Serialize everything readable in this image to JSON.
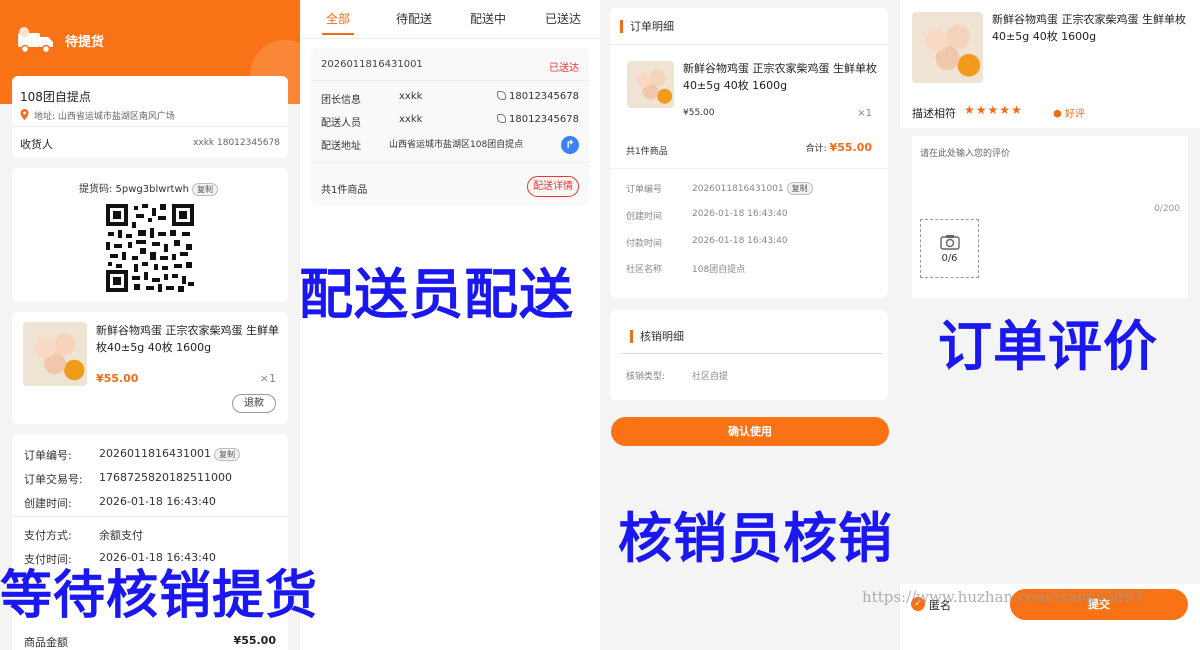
{
  "product": {
    "name": "新鲜谷物鸡蛋 正宗农家柴鸡蛋 生鲜单枚40±5g 40枚 1600g",
    "price": "¥55.00",
    "price_plain": "¥55.00",
    "qty": "×1"
  },
  "pickup_screen": {
    "header_title": "待提货",
    "store_name": "108团自提点",
    "address": "地址: 山西省运城市盐湖区南风广场",
    "receiver_label": "收货人",
    "receiver_value": "xxkk  18012345678",
    "pickup_code": "提货码: 5pwg3blwrtwh",
    "copy_label": "复制",
    "refund_label": "退款",
    "order_no_label": "订单编号:",
    "order_no": "2026011816431001",
    "trade_no_label": "订单交易号:",
    "trade_no": "1768725820182511000",
    "created_label": "创建时间:",
    "created": "2026-01-18 16:43:40",
    "pay_method_label": "支付方式:",
    "pay_method": "余额支付",
    "pay_time_label": "支付时间:",
    "pay_time": "2026-01-18 16:43:40",
    "goods_amount_label": "商品金额",
    "goods_amount": "¥55.00",
    "overlay_label": "等待核销提货"
  },
  "delivery_screen": {
    "tabs": [
      "全部",
      "待配送",
      "配送中",
      "已送达"
    ],
    "order_no": "2026011816431001",
    "status": "已送达",
    "leader_label": "团长信息",
    "leader_name": "xxkk",
    "leader_phone": "18012345678",
    "courier_label": "配送人员",
    "courier_name": "xxkk",
    "courier_phone": "18012345678",
    "address_label": "配送地址",
    "address_value": "山西省运城市盐湖区108团自提点",
    "count": "共1件商品",
    "detail_button": "配送详情",
    "overlay_label": "配送员配送"
  },
  "verify_screen": {
    "order_detail_title": "订单明细",
    "count": "共1件商品",
    "total_label": "合计:",
    "total": "¥55.00",
    "order_no_label": "订单编号",
    "order_no": "2026011816431001",
    "copy_label": "复制",
    "created_label": "创建时间",
    "created": "2026-01-18 16:43:40",
    "paid_label": "付款时间",
    "paid": "2026-01-18 16:43:40",
    "community_label": "社区名称",
    "community": "108团自提点",
    "verify_title": "核销明细",
    "verify_type_label": "核销类型:",
    "verify_type": "社区自提",
    "confirm_button": "确认使用",
    "overlay_label": "核销员核销"
  },
  "review_screen": {
    "rating_label": "描述相符",
    "rating": 5,
    "rating_max": 5,
    "rating_text": "好评",
    "placeholder": "请在此处输入您的评价",
    "char_count": "0/200",
    "photo_count": "0/6",
    "anonymous_label": "匿名",
    "submit_button": "提交",
    "overlay_label": "订单评价"
  },
  "watermark": "https://www.huzhan.com/ishop45993",
  "colors": {
    "accent": "#f97316",
    "overlay_text": "#1a17f0"
  }
}
